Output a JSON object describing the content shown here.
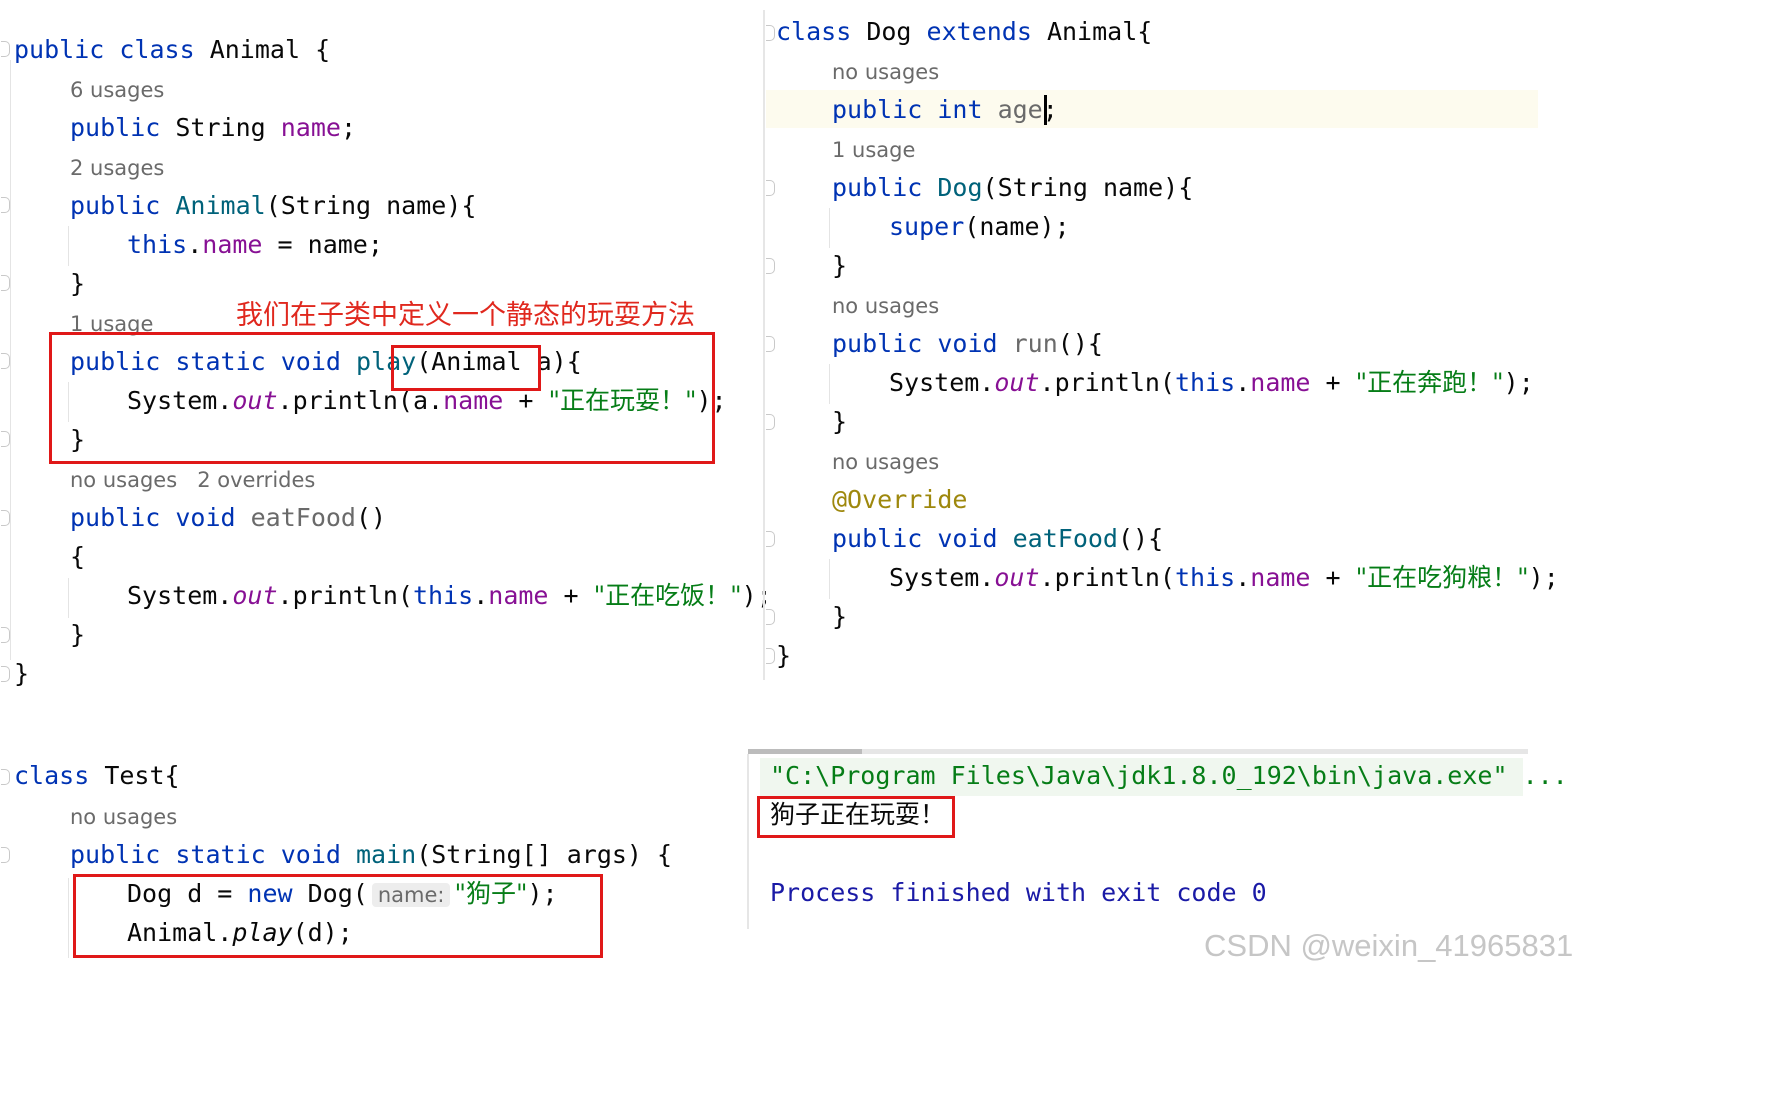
{
  "annotation": {
    "text": "我们在子类中定义一个静态的玩耍方法"
  },
  "animal_class": {
    "kw_public": "public",
    "kw_class": "class",
    "name": "Animal",
    "open": " {",
    "hint_name_usages": "6 usages",
    "field_kw": "public",
    "field_type": " String ",
    "field_name": "name",
    "field_end": ";",
    "hint_ctor_usages": "2 usages",
    "ctor_kw": "public",
    "ctor_name": "Animal",
    "ctor_params": "(String name){",
    "ctor_this": "this",
    "ctor_dot": ".",
    "ctor_field": "name",
    "ctor_assign": " = name;",
    "ctor_close": "}",
    "hint_play_usages": "1 usage",
    "play_kw": "public static void",
    "play_name": " play",
    "play_params": "(Animal a)",
    "play_open": "{",
    "play_body_sys": "System.",
    "play_body_out": "out",
    "play_body_println": ".println(a.",
    "play_body_field": "name",
    "play_body_plus": " + ",
    "play_body_str": "\"正在玩耍！\"",
    "play_body_end": ");",
    "play_close": "}",
    "hint_eat_usages": "no usages",
    "hint_eat_overrides": "2 overrides",
    "eat_kw": "public void",
    "eat_name": " eatFood",
    "eat_parens": "()",
    "eat_open": "{",
    "eat_body_sys": "System.",
    "eat_body_out": "out",
    "eat_body_println": ".println(",
    "eat_body_this": "this",
    "eat_body_dot": ".",
    "eat_body_field": "name",
    "eat_body_plus": " + ",
    "eat_body_str": "\"正在吃饭！\"",
    "eat_body_end": ");",
    "eat_close": "}",
    "class_close": "}"
  },
  "dog_class": {
    "kw_class": "class",
    "name": " Dog ",
    "kw_extends": "extends",
    "parent": " Animal{",
    "hint_age_usages": "no usages",
    "age_kw": "public int",
    "age_name": " age",
    "age_end": ";",
    "hint_ctor_usages": "1 usage",
    "ctor_kw": "public",
    "ctor_name": " Dog",
    "ctor_params": "(String name){",
    "ctor_super": "super",
    "ctor_super_args": "(name);",
    "ctor_close": "}",
    "hint_run_usages": "no usages",
    "run_kw": "public void",
    "run_name": " run",
    "run_parens": "(){",
    "run_body_sys": "System.",
    "run_body_out": "out",
    "run_body_println": ".println(",
    "run_body_this": "this",
    "run_body_dot": ".",
    "run_body_field": "name",
    "run_body_plus": " + ",
    "run_body_str": "\"正在奔跑！\"",
    "run_body_end": ");",
    "run_close": "}",
    "hint_eat_usages": "no usages",
    "eat_anno": "@Override",
    "eat_kw": "public void",
    "eat_name": " eatFood",
    "eat_parens": "(){",
    "eat_body_sys": "System.",
    "eat_body_out": "out",
    "eat_body_println": ".println(",
    "eat_body_this": "this",
    "eat_body_dot": ".",
    "eat_body_field": "name",
    "eat_body_plus": " + ",
    "eat_body_str": "\"正在吃狗粮！\"",
    "eat_body_end": ");",
    "eat_close": "}",
    "class_close": "}"
  },
  "test_class": {
    "kw_class": "class",
    "name": " Test{",
    "hint_main_usages": "no usages",
    "main_kw": "public static void",
    "main_name": " main",
    "main_params": "(String[] args) {",
    "line1_type": "Dog d = ",
    "line1_new": "new",
    "line1_ctor": " Dog(",
    "line1_hint": "name:",
    "line1_str": "\"狗子\"",
    "line1_end": ");",
    "line2_recv": "Animal.",
    "line2_method": "play",
    "line2_args": "(d);"
  },
  "console": {
    "command": "\"C:\\Program Files\\Java\\jdk1.8.0_192\\bin\\java.exe\" ...",
    "output": "狗子正在玩耍！",
    "exit": "Process finished with exit code 0"
  },
  "watermark": {
    "text": "CSDN @weixin_41965831"
  },
  "colors": {
    "keyword": "#0033b3",
    "field": "#871094",
    "method_decl": "#00627a",
    "string": "#067d17",
    "annotation": "#9e880d",
    "hint": "#6a6a6a",
    "red_box": "#e01818",
    "red_text": "#e0281e",
    "console_text": "#1a1aa6"
  }
}
